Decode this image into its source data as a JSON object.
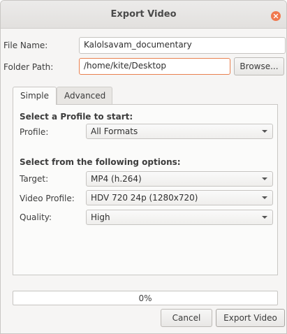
{
  "window": {
    "title": "Export Video"
  },
  "fields": {
    "file_name_label": "File Name:",
    "file_name_value": "Kalolsavam_documentary",
    "folder_path_label": "Folder Path:",
    "folder_path_value": "/home/kite/Desktop",
    "browse_label": "Browse..."
  },
  "tabs": [
    {
      "label": "Simple",
      "active": true
    },
    {
      "label": "Advanced",
      "active": false
    }
  ],
  "simple": {
    "profile_section_title": "Select a Profile to start:",
    "profile_label": "Profile:",
    "profile_value": "All Formats",
    "options_section_title": "Select from the following options:",
    "target_label": "Target:",
    "target_value": "MP4 (h.264)",
    "video_profile_label": "Video Profile:",
    "video_profile_value": "HDV 720 24p (1280x720)",
    "quality_label": "Quality:",
    "quality_value": "High"
  },
  "progress": {
    "value": 0,
    "text": "0%"
  },
  "buttons": {
    "cancel": "Cancel",
    "export": "Export Video"
  },
  "colors": {
    "accent": "#e9804f",
    "close": "#f0794f"
  }
}
